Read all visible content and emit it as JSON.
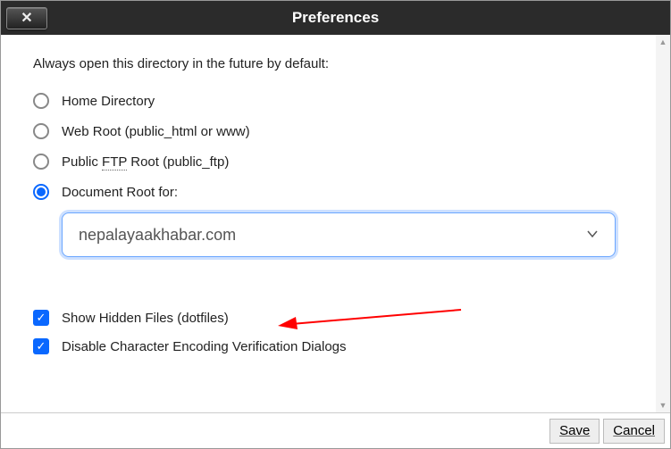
{
  "dialog": {
    "title": "Preferences"
  },
  "section": {
    "default_dir_label": "Always open this directory in the future by default:",
    "radios": [
      {
        "label": "Home Directory",
        "selected": false
      },
      {
        "label_pre": "Web Root (public_html or www)",
        "selected": false
      },
      {
        "label_pre": "Public ",
        "abbr": "FTP",
        "label_post": " Root (public_ftp)",
        "selected": false
      },
      {
        "label": "Document Root for:",
        "selected": true
      }
    ],
    "document_root_value": "nepalayaakhabar.com"
  },
  "checkboxes": {
    "show_hidden": {
      "label": "Show Hidden Files (dotfiles)",
      "checked": true
    },
    "disable_enc": {
      "label": "Disable Character Encoding Verification Dialogs",
      "checked": true
    }
  },
  "footer": {
    "save": "Save",
    "cancel": "Cancel"
  }
}
